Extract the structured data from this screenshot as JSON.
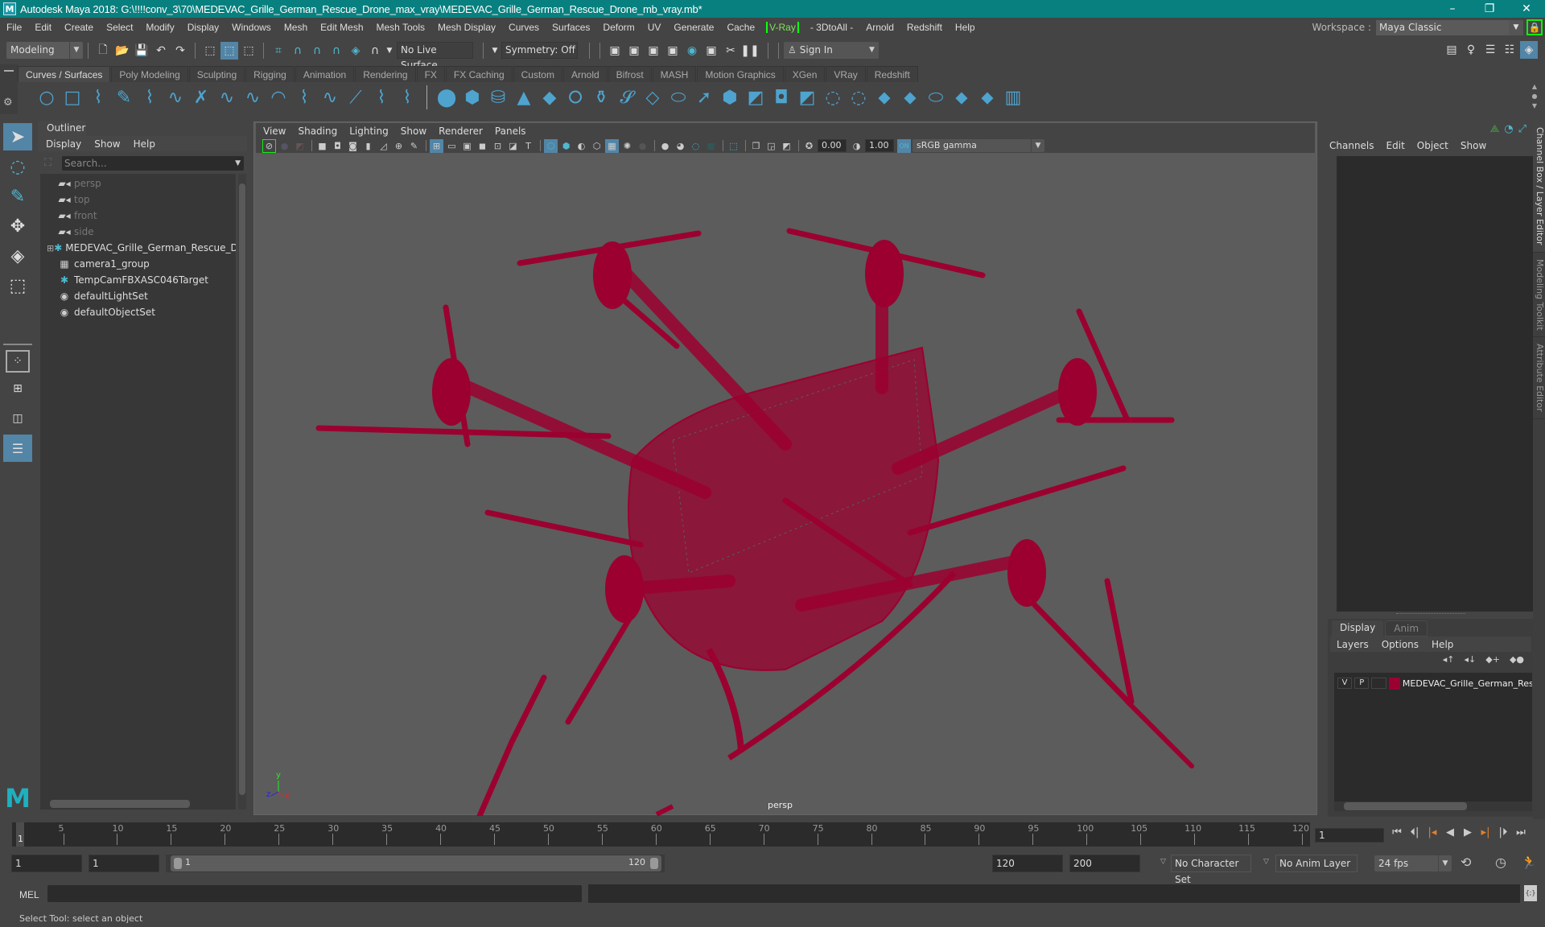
{
  "window": {
    "title": "Autodesk Maya 2018: G:\\!!!!conv_3\\70\\MEDEVAC_Grille_German_Rescue_Drone_max_vray\\MEDEVAC_Grille_German_Rescue_Drone_mb_vray.mb*",
    "logo": "M",
    "minimize": "–",
    "maximize": "❐",
    "close": "✕"
  },
  "menubar": {
    "items": [
      "File",
      "Edit",
      "Create",
      "Select",
      "Modify",
      "Display",
      "Windows",
      "Mesh",
      "Edit Mesh",
      "Mesh Tools",
      "Mesh Display",
      "Curves",
      "Surfaces",
      "Deform",
      "UV",
      "Generate",
      "Cache"
    ],
    "vray": "V-Ray",
    "items_after": [
      "- 3DtoAll -",
      "Arnold",
      "Redshift",
      "Help"
    ]
  },
  "workspace": {
    "label": "Workspace :",
    "value": "Maya Classic"
  },
  "statusline": {
    "mode": "Modeling",
    "live_surface": "No Live Surface",
    "symmetry": "Symmetry: Off",
    "sign_in": "Sign In"
  },
  "shelf": {
    "tabs": [
      "Curves / Surfaces",
      "Poly Modeling",
      "Sculpting",
      "Rigging",
      "Animation",
      "Rendering",
      "FX",
      "FX Caching",
      "Custom",
      "Arnold",
      "Bifrost",
      "MASH",
      "Motion Graphics",
      "XGen",
      "VRay",
      "Redshift"
    ],
    "active_tab": "Curves / Surfaces",
    "curve_icons": [
      "nurbs-circle",
      "nurbs-square",
      "cv-curve",
      "pencil-curve",
      "ep-curve",
      "bezier-curve",
      "curve-edit",
      "cut-curve",
      "attach-curve",
      "extend-curve",
      "offset-curve",
      "rebuild-curve",
      "reverse-curve",
      "bezier-tool",
      "insert-knot"
    ],
    "surface_icons": [
      "nurbs-sphere",
      "nurbs-cube",
      "nurbs-cylinder",
      "nurbs-cone",
      "nurbs-plane",
      "nurbs-torus",
      "revolve",
      "loft",
      "planar",
      "extrude",
      "birail",
      "bevel",
      "boundary",
      "square",
      "trim",
      "untrim",
      "fillet",
      "stitch",
      "project-curve",
      "intersect",
      "offset-surface",
      "sculpt",
      "lattice"
    ]
  },
  "outliner": {
    "tab": "Outliner",
    "menu": [
      "Display",
      "Show",
      "Help"
    ],
    "search_placeholder": "Search...",
    "items": [
      {
        "label": "persp",
        "icon": "camera-icon",
        "dim": true
      },
      {
        "label": "top",
        "icon": "camera-icon",
        "dim": true
      },
      {
        "label": "front",
        "icon": "camera-icon",
        "dim": true
      },
      {
        "label": "side",
        "icon": "camera-icon",
        "dim": true
      },
      {
        "label": "MEDEVAC_Grille_German_Rescue_Drc",
        "icon": "transform-icon",
        "expandable": true
      },
      {
        "label": "camera1_group",
        "icon": "group-icon"
      },
      {
        "label": "TempCamFBXASC046Target",
        "icon": "transform-icon"
      },
      {
        "label": "defaultLightSet",
        "icon": "set-icon"
      },
      {
        "label": "defaultObjectSet",
        "icon": "set-icon"
      }
    ]
  },
  "viewport": {
    "menu": [
      "View",
      "Shading",
      "Lighting",
      "Show",
      "Renderer",
      "Panels"
    ],
    "exposure": "0.00",
    "gamma": "1.00",
    "color_space": "sRGB gamma",
    "camera_label": "persp",
    "axis": {
      "x": "x",
      "y": "y",
      "z": "z"
    },
    "wire_color": "#9b0030"
  },
  "channelbox": {
    "menu": [
      "Channels",
      "Edit",
      "Object",
      "Show"
    ]
  },
  "layer_editor": {
    "tabs": [
      "Display",
      "Anim"
    ],
    "active_tab": "Display",
    "menu": [
      "Layers",
      "Options",
      "Help"
    ],
    "layers": [
      {
        "v": "V",
        "p": "P",
        "color": "#9b0030",
        "name": "MEDEVAC_Grille_German_Resc"
      }
    ]
  },
  "right_tabs": [
    "Channel Box / Layer Editor",
    "Modeling Toolkit",
    "Attribute Editor"
  ],
  "timeline": {
    "ticks": [
      5,
      10,
      15,
      20,
      25,
      30,
      35,
      40,
      45,
      50,
      55,
      60,
      65,
      70,
      75,
      80,
      85,
      90,
      95,
      100,
      105,
      110,
      115,
      120
    ],
    "start": 1,
    "end": 120,
    "current_frame": "1",
    "current_marker": "1"
  },
  "range": {
    "start_field": "1",
    "playback_start": "1",
    "slider_start": "1",
    "slider_end": "120",
    "playback_end": "120",
    "end_field": "200",
    "character_set": "No Character Set",
    "anim_layer": "No Anim Layer",
    "fps": "24 fps"
  },
  "cmdline": {
    "label": "MEL"
  },
  "status": {
    "text": "Select Tool: select an object"
  }
}
